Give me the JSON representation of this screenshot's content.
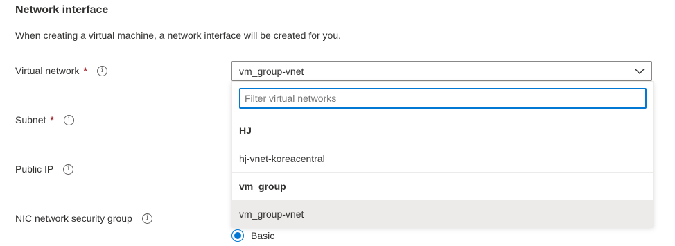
{
  "section": {
    "title": "Network interface",
    "description": "When creating a virtual machine, a network interface will be created for you."
  },
  "fields": {
    "virtual_network": {
      "label": "Virtual network",
      "required": "*"
    },
    "subnet": {
      "label": "Subnet",
      "required": "*"
    },
    "public_ip": {
      "label": "Public IP"
    },
    "nic_nsg": {
      "label": "NIC network security group"
    }
  },
  "info_glyph": "i",
  "select": {
    "value": "vm_group-vnet"
  },
  "dropdown": {
    "filter_placeholder": "Filter virtual networks",
    "groups": [
      {
        "header": "HJ",
        "options": [
          "hj-vnet-koreacentral"
        ]
      },
      {
        "header": "vm_group",
        "options": [
          "vm_group-vnet"
        ]
      }
    ],
    "selected_option": "vm_group-vnet"
  },
  "nsg_radio": {
    "label": "Basic",
    "checked": true
  },
  "colors": {
    "accent": "#0078d4",
    "required": "#a4262c",
    "selected_bg": "#edebe9"
  },
  "icons": {
    "dropdown": "chevron-down-icon",
    "info": "info-icon"
  }
}
